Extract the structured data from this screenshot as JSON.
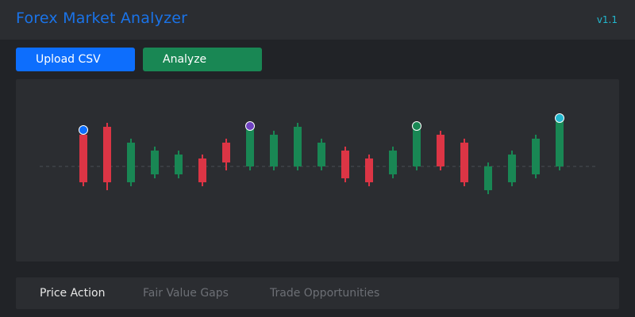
{
  "app": {
    "title": "Forex Market Analyzer",
    "version": "v1.1"
  },
  "toolbar": {
    "upload_label": "Upload CSV",
    "analyze_label": "Analyze"
  },
  "tabs": [
    {
      "label": "Price Action",
      "active": true
    },
    {
      "label": "Fair Value Gaps",
      "active": false
    },
    {
      "label": "Trade Opportunities",
      "active": false
    }
  ],
  "colors": {
    "accent": "#1a73e8",
    "version": "#22b8cf",
    "upload_button": "#0d6efd",
    "analyze_button": "#198754",
    "bullish": "#198754",
    "bearish": "#dc3545"
  },
  "chart_data": {
    "type": "candlestick",
    "baseline": 0,
    "ylim": [
      -11,
      11
    ],
    "candles": [
      {
        "open": -4,
        "close": 8,
        "high": 9,
        "low": -5
      },
      {
        "open": -4,
        "close": 10,
        "high": 11,
        "low": -6
      },
      {
        "open": -4,
        "close": 6,
        "high": 7,
        "low": -5
      },
      {
        "open": -2,
        "close": 4,
        "high": 5,
        "low": -3
      },
      {
        "open": -2,
        "close": 3,
        "high": 4,
        "low": -3
      },
      {
        "open": -4,
        "close": 2,
        "high": 3,
        "low": -5
      },
      {
        "open": 1,
        "close": 6,
        "high": 7,
        "low": -1
      },
      {
        "open": 0,
        "close": 10,
        "high": 11,
        "low": -1
      },
      {
        "open": 0,
        "close": 8,
        "high": 9,
        "low": -1
      },
      {
        "open": 0,
        "close": 10,
        "high": 11,
        "low": -1
      },
      {
        "open": 0,
        "close": 6,
        "high": 7,
        "low": -1
      },
      {
        "open": -3,
        "close": 4,
        "high": 5,
        "low": -4
      },
      {
        "open": -4,
        "close": 2,
        "high": 3,
        "low": -5
      },
      {
        "open": -2,
        "close": 4,
        "high": 5,
        "low": -3
      },
      {
        "open": 0,
        "close": 10,
        "high": 11,
        "low": -1
      },
      {
        "open": 0,
        "close": 8,
        "high": 9,
        "low": -1
      },
      {
        "open": -4,
        "close": 6,
        "high": 7,
        "low": -5
      },
      {
        "open": -6,
        "close": 0,
        "high": 1,
        "low": -7
      },
      {
        "open": -4,
        "close": 3,
        "high": 4,
        "low": -5
      },
      {
        "open": -2,
        "close": 7,
        "high": 8,
        "low": -3
      },
      {
        "open": 0,
        "close": 12,
        "high": 13,
        "low": -1
      }
    ],
    "markers": [
      {
        "index": 0,
        "value": 9,
        "color": "#0d6efd"
      },
      {
        "index": 7,
        "value": 10,
        "color": "#6f42c1"
      },
      {
        "index": 14,
        "value": 10,
        "color": "#198754"
      },
      {
        "index": 20,
        "value": 12,
        "color": "#22b8cf"
      }
    ],
    "bearish_indices": [
      0,
      1,
      5,
      6,
      11,
      12,
      15,
      16
    ]
  }
}
